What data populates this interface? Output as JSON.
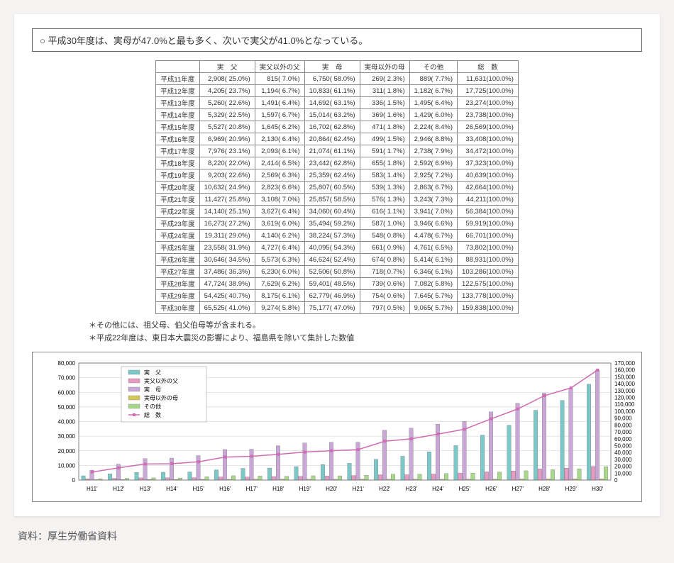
{
  "headline": "平成30年度は、実母が47.0%と最も多く、次いで実父が41.0%となっている。",
  "columns": [
    "実　父",
    "実父以外の父",
    "実　母",
    "実母以外の母",
    "その他",
    "総　数"
  ],
  "rows": [
    {
      "y": "平成11年度",
      "c": [
        "2,908( 25.0%)",
        "815(  7.0%)",
        "6,750( 58.0%)",
        "269(  2.3%)",
        "889(  7.7%)",
        "11,631(100.0%)"
      ]
    },
    {
      "y": "平成12年度",
      "c": [
        "4,205( 23.7%)",
        "1,194(  6.7%)",
        "10,833( 61.1%)",
        "311(  1.8%)",
        "1,182(  6.7%)",
        "17,725(100.0%)"
      ]
    },
    {
      "y": "平成13年度",
      "c": [
        "5,260( 22.6%)",
        "1,491(  6.4%)",
        "14,692( 63.1%)",
        "336(  1.5%)",
        "1,495(  6.4%)",
        "23,274(100.0%)"
      ]
    },
    {
      "y": "平成14年度",
      "c": [
        "5,329( 22.5%)",
        "1,597(  6.7%)",
        "15,014( 63.2%)",
        "369(  1.6%)",
        "1,429(  6.0%)",
        "23,738(100.0%)"
      ]
    },
    {
      "y": "平成15年度",
      "c": [
        "5,527( 20.8%)",
        "1,645(  6.2%)",
        "16,702( 62.8%)",
        "471(  1.8%)",
        "2,224(  8.4%)",
        "26,569(100.0%)"
      ]
    },
    {
      "y": "平成16年度",
      "c": [
        "6,969( 20.9%)",
        "2,130(  6.4%)",
        "20,864( 62.4%)",
        "499(  1.5%)",
        "2,946(  8.8%)",
        "33,408(100.0%)"
      ]
    },
    {
      "y": "平成17年度",
      "c": [
        "7,976( 23.1%)",
        "2,093(  6.1%)",
        "21,074( 61.1%)",
        "591(  1.7%)",
        "2,738(  7.9%)",
        "34,472(100.0%)"
      ]
    },
    {
      "y": "平成18年度",
      "c": [
        "8,220( 22.0%)",
        "2,414(  6.5%)",
        "23,442( 62.8%)",
        "655(  1.8%)",
        "2,592(  6.9%)",
        "37,323(100.0%)"
      ]
    },
    {
      "y": "平成19年度",
      "c": [
        "9,203( 22.6%)",
        "2,569(  6.3%)",
        "25,359( 62.4%)",
        "583(  1.4%)",
        "2,925(  7.2%)",
        "40,639(100.0%)"
      ]
    },
    {
      "y": "平成20年度",
      "c": [
        "10,632( 24.9%)",
        "2,823(  6.6%)",
        "25,807( 60.5%)",
        "539(  1.3%)",
        "2,863(  6.7%)",
        "42,664(100.0%)"
      ]
    },
    {
      "y": "平成21年度",
      "c": [
        "11,427( 25.8%)",
        "3,108(  7.0%)",
        "25,857( 58.5%)",
        "576(  1.3%)",
        "3,243(  7.3%)",
        "44,211(100.0%)"
      ]
    },
    {
      "y": "平成22年度",
      "c": [
        "14,140( 25.1%)",
        "3,627(  6.4%)",
        "34,060( 60.4%)",
        "616(  1.1%)",
        "3,941(  7.0%)",
        "56,384(100.0%)"
      ]
    },
    {
      "y": "平成23年度",
      "c": [
        "16,273( 27.2%)",
        "3,619(  6.0%)",
        "35,494( 59.2%)",
        "587(  1.0%)",
        "3,946(  6.6%)",
        "59,919(100.0%)"
      ]
    },
    {
      "y": "平成24年度",
      "c": [
        "19,311( 29.0%)",
        "4,140(  6.2%)",
        "38,224( 57.3%)",
        "548(  0.8%)",
        "4,478(  6.7%)",
        "66,701(100.0%)"
      ]
    },
    {
      "y": "平成25年度",
      "c": [
        "23,558( 31.9%)",
        "4,727(  6.4%)",
        "40,095( 54.3%)",
        "661(  0.9%)",
        "4,761(  6.5%)",
        "73,802(100.0%)"
      ]
    },
    {
      "y": "平成26年度",
      "c": [
        "30,646( 34.5%)",
        "5,573(  6.3%)",
        "46,624( 52.4%)",
        "674(  0.8%)",
        "5,414(  6.1%)",
        "88,931(100.0%)"
      ]
    },
    {
      "y": "平成27年度",
      "c": [
        "37,486( 36.3%)",
        "6,230(  6.0%)",
        "52,506( 50.8%)",
        "718(  0.7%)",
        "6,346(  6.1%)",
        "103,286(100.0%)"
      ]
    },
    {
      "y": "平成28年度",
      "c": [
        "47,724( 38.9%)",
        "7,629(  6.2%)",
        "59,401( 48.5%)",
        "739(  0.6%)",
        "7,082(  5.8%)",
        "122,575(100.0%)"
      ]
    },
    {
      "y": "平成29年度",
      "c": [
        "54,425( 40.7%)",
        "8,175(  6.1%)",
        "62,779( 46.9%)",
        "754(  0.6%)",
        "7,645(  5.7%)",
        "133,778(100.0%)"
      ]
    },
    {
      "y": "平成30年度",
      "c": [
        "65,525( 41.0%)",
        "9,274(  5.8%)",
        "75,177( 47.0%)",
        "797(  0.5%)",
        "9,065(  5.7%)",
        "159,838(100.0%)"
      ]
    }
  ],
  "notes": [
    "＊その他には、祖父母、伯父伯母等が含まれる。",
    "＊平成22年度は、東日本大震災の影響により、福島県を除いて集計した数値"
  ],
  "source": "資料：厚生労働省資料",
  "legend": [
    "実　父",
    "実父以外の父",
    "実　母",
    "実母以外の母",
    "その他",
    "総　数"
  ],
  "chart_data": {
    "type": "bar+line",
    "categories": [
      "H11'",
      "H12'",
      "H13'",
      "H14'",
      "H15'",
      "H16'",
      "H17'",
      "H18'",
      "H19'",
      "H20'",
      "H21'",
      "H22'",
      "H23'",
      "H24'",
      "H25'",
      "H26'",
      "H27'",
      "H28'",
      "H29'",
      "H30'"
    ],
    "left_axis": {
      "min": 0,
      "max": 80000,
      "step": 10000
    },
    "right_axis": {
      "min": 0,
      "max": 170000,
      "step": 10000
    },
    "series": [
      {
        "name": "実父",
        "type": "bar",
        "axis": "left",
        "color": "#7cc8c8",
        "values": [
          2908,
          4205,
          5260,
          5329,
          5527,
          6969,
          7976,
          8220,
          9203,
          10632,
          11427,
          14140,
          16273,
          19311,
          23558,
          30646,
          37486,
          47724,
          54425,
          65525
        ]
      },
      {
        "name": "実父以外の父",
        "type": "bar",
        "axis": "left",
        "color": "#e89bc2",
        "values": [
          815,
          1194,
          1491,
          1597,
          1645,
          2130,
          2093,
          2414,
          2569,
          2823,
          3108,
          3627,
          3619,
          4140,
          4727,
          5573,
          6230,
          7629,
          8175,
          9274
        ]
      },
      {
        "name": "実母",
        "type": "bar",
        "axis": "left",
        "color": "#c9a8d8",
        "values": [
          6750,
          10833,
          14692,
          15014,
          16702,
          20864,
          21074,
          23442,
          25359,
          25807,
          25857,
          34060,
          35494,
          38224,
          40095,
          46624,
          52506,
          59401,
          62779,
          75177
        ]
      },
      {
        "name": "実母以外の母",
        "type": "bar",
        "axis": "left",
        "color": "#d4c85a",
        "values": [
          269,
          311,
          336,
          369,
          471,
          499,
          591,
          655,
          583,
          539,
          576,
          616,
          587,
          548,
          661,
          674,
          718,
          739,
          754,
          797
        ]
      },
      {
        "name": "その他",
        "type": "bar",
        "axis": "left",
        "color": "#a8d88a",
        "values": [
          889,
          1182,
          1495,
          1429,
          2224,
          2946,
          2738,
          2592,
          2925,
          2863,
          3243,
          3941,
          3946,
          4478,
          4761,
          5414,
          6346,
          7082,
          7645,
          9065
        ]
      },
      {
        "name": "総数",
        "type": "line",
        "axis": "right",
        "color": "#d06bb5",
        "values": [
          11631,
          17725,
          23274,
          23738,
          26569,
          33408,
          34472,
          37323,
          40639,
          42664,
          44211,
          56384,
          59919,
          66701,
          73802,
          88931,
          103286,
          122575,
          133778,
          159838
        ]
      }
    ]
  }
}
